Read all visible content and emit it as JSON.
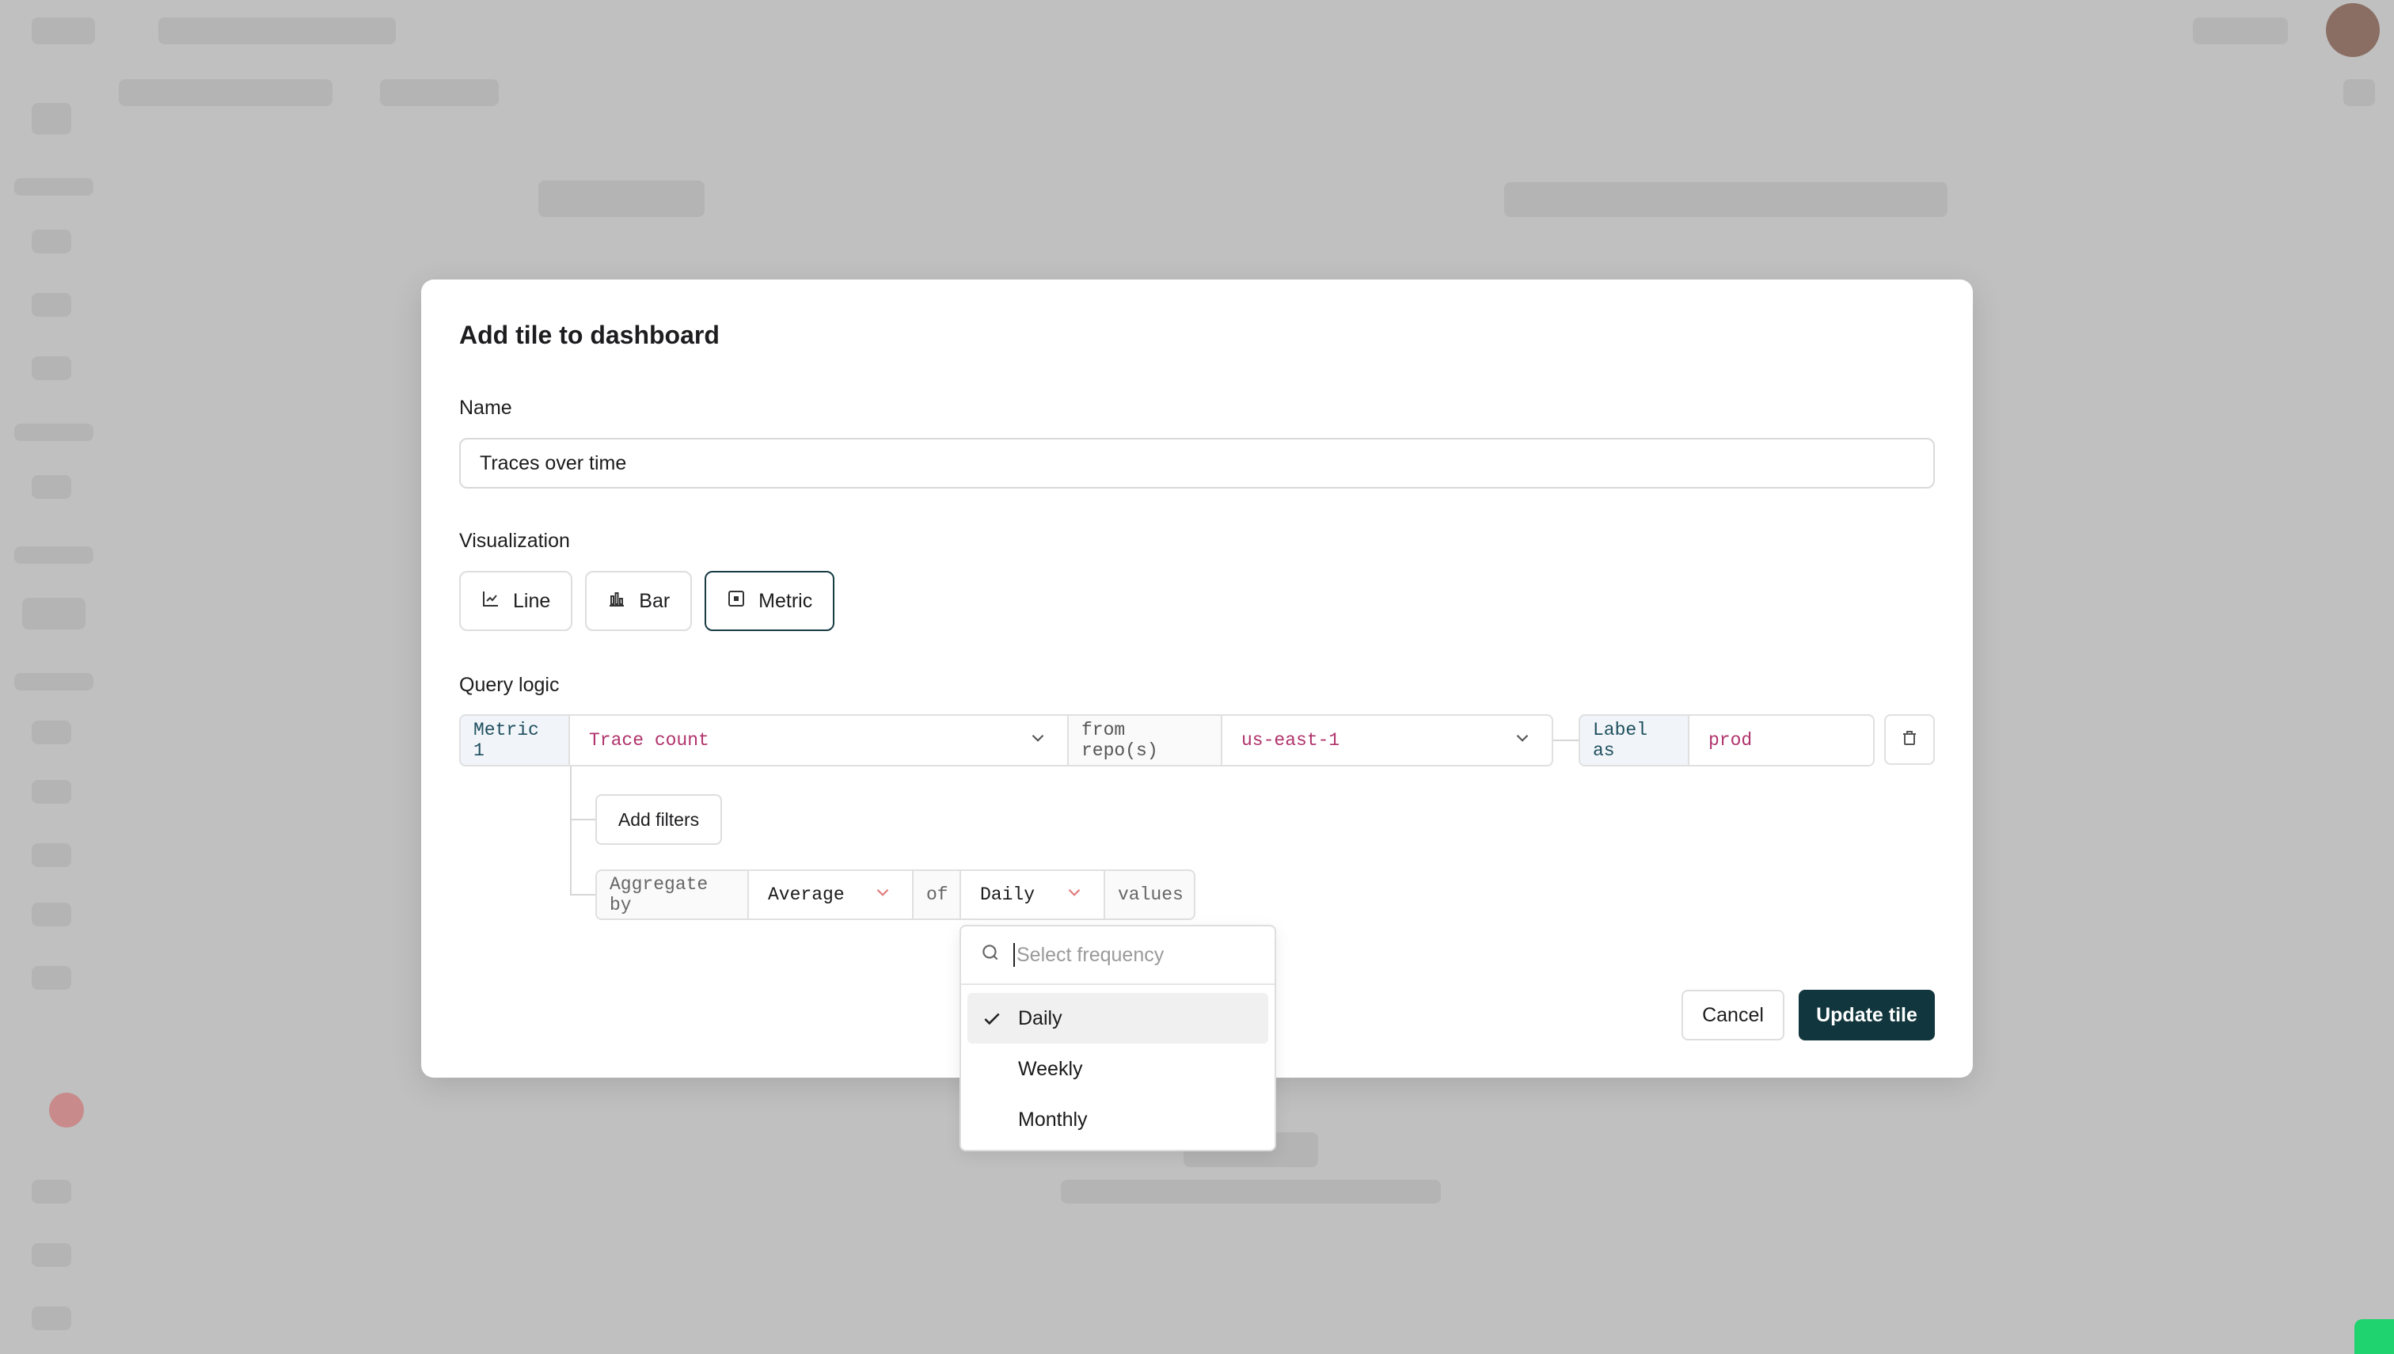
{
  "modal": {
    "title": "Add tile to dashboard",
    "name_label": "Name",
    "name_value": "Traces over time",
    "visualization_label": "Visualization",
    "viz_options": [
      {
        "label": "Line",
        "icon": "line-chart-icon",
        "active": false
      },
      {
        "label": "Bar",
        "icon": "bar-chart-icon",
        "active": false
      },
      {
        "label": "Metric",
        "icon": "metric-box-icon",
        "active": true
      }
    ],
    "query_label": "Query logic",
    "query": {
      "metric_tag": "Metric 1",
      "metric_value": "Trace count",
      "from_label": "from repo(s)",
      "repo_value": "us-east-1",
      "label_as": "Label as",
      "label_value": "prod"
    },
    "add_filters": "Add filters",
    "aggregate": {
      "prefix": "Aggregate by",
      "function": "Average",
      "of_label": "of",
      "frequency": "Daily",
      "suffix": "values"
    },
    "cancel": "Cancel",
    "update": "Update tile"
  },
  "dropdown": {
    "placeholder": "Select frequency",
    "options": [
      {
        "label": "Daily",
        "selected": true
      },
      {
        "label": "Weekly",
        "selected": false
      },
      {
        "label": "Monthly",
        "selected": false
      }
    ]
  },
  "colors": {
    "accent": "#12363d",
    "value_text": "#b0336c",
    "overlay": "#bdbdbd"
  }
}
